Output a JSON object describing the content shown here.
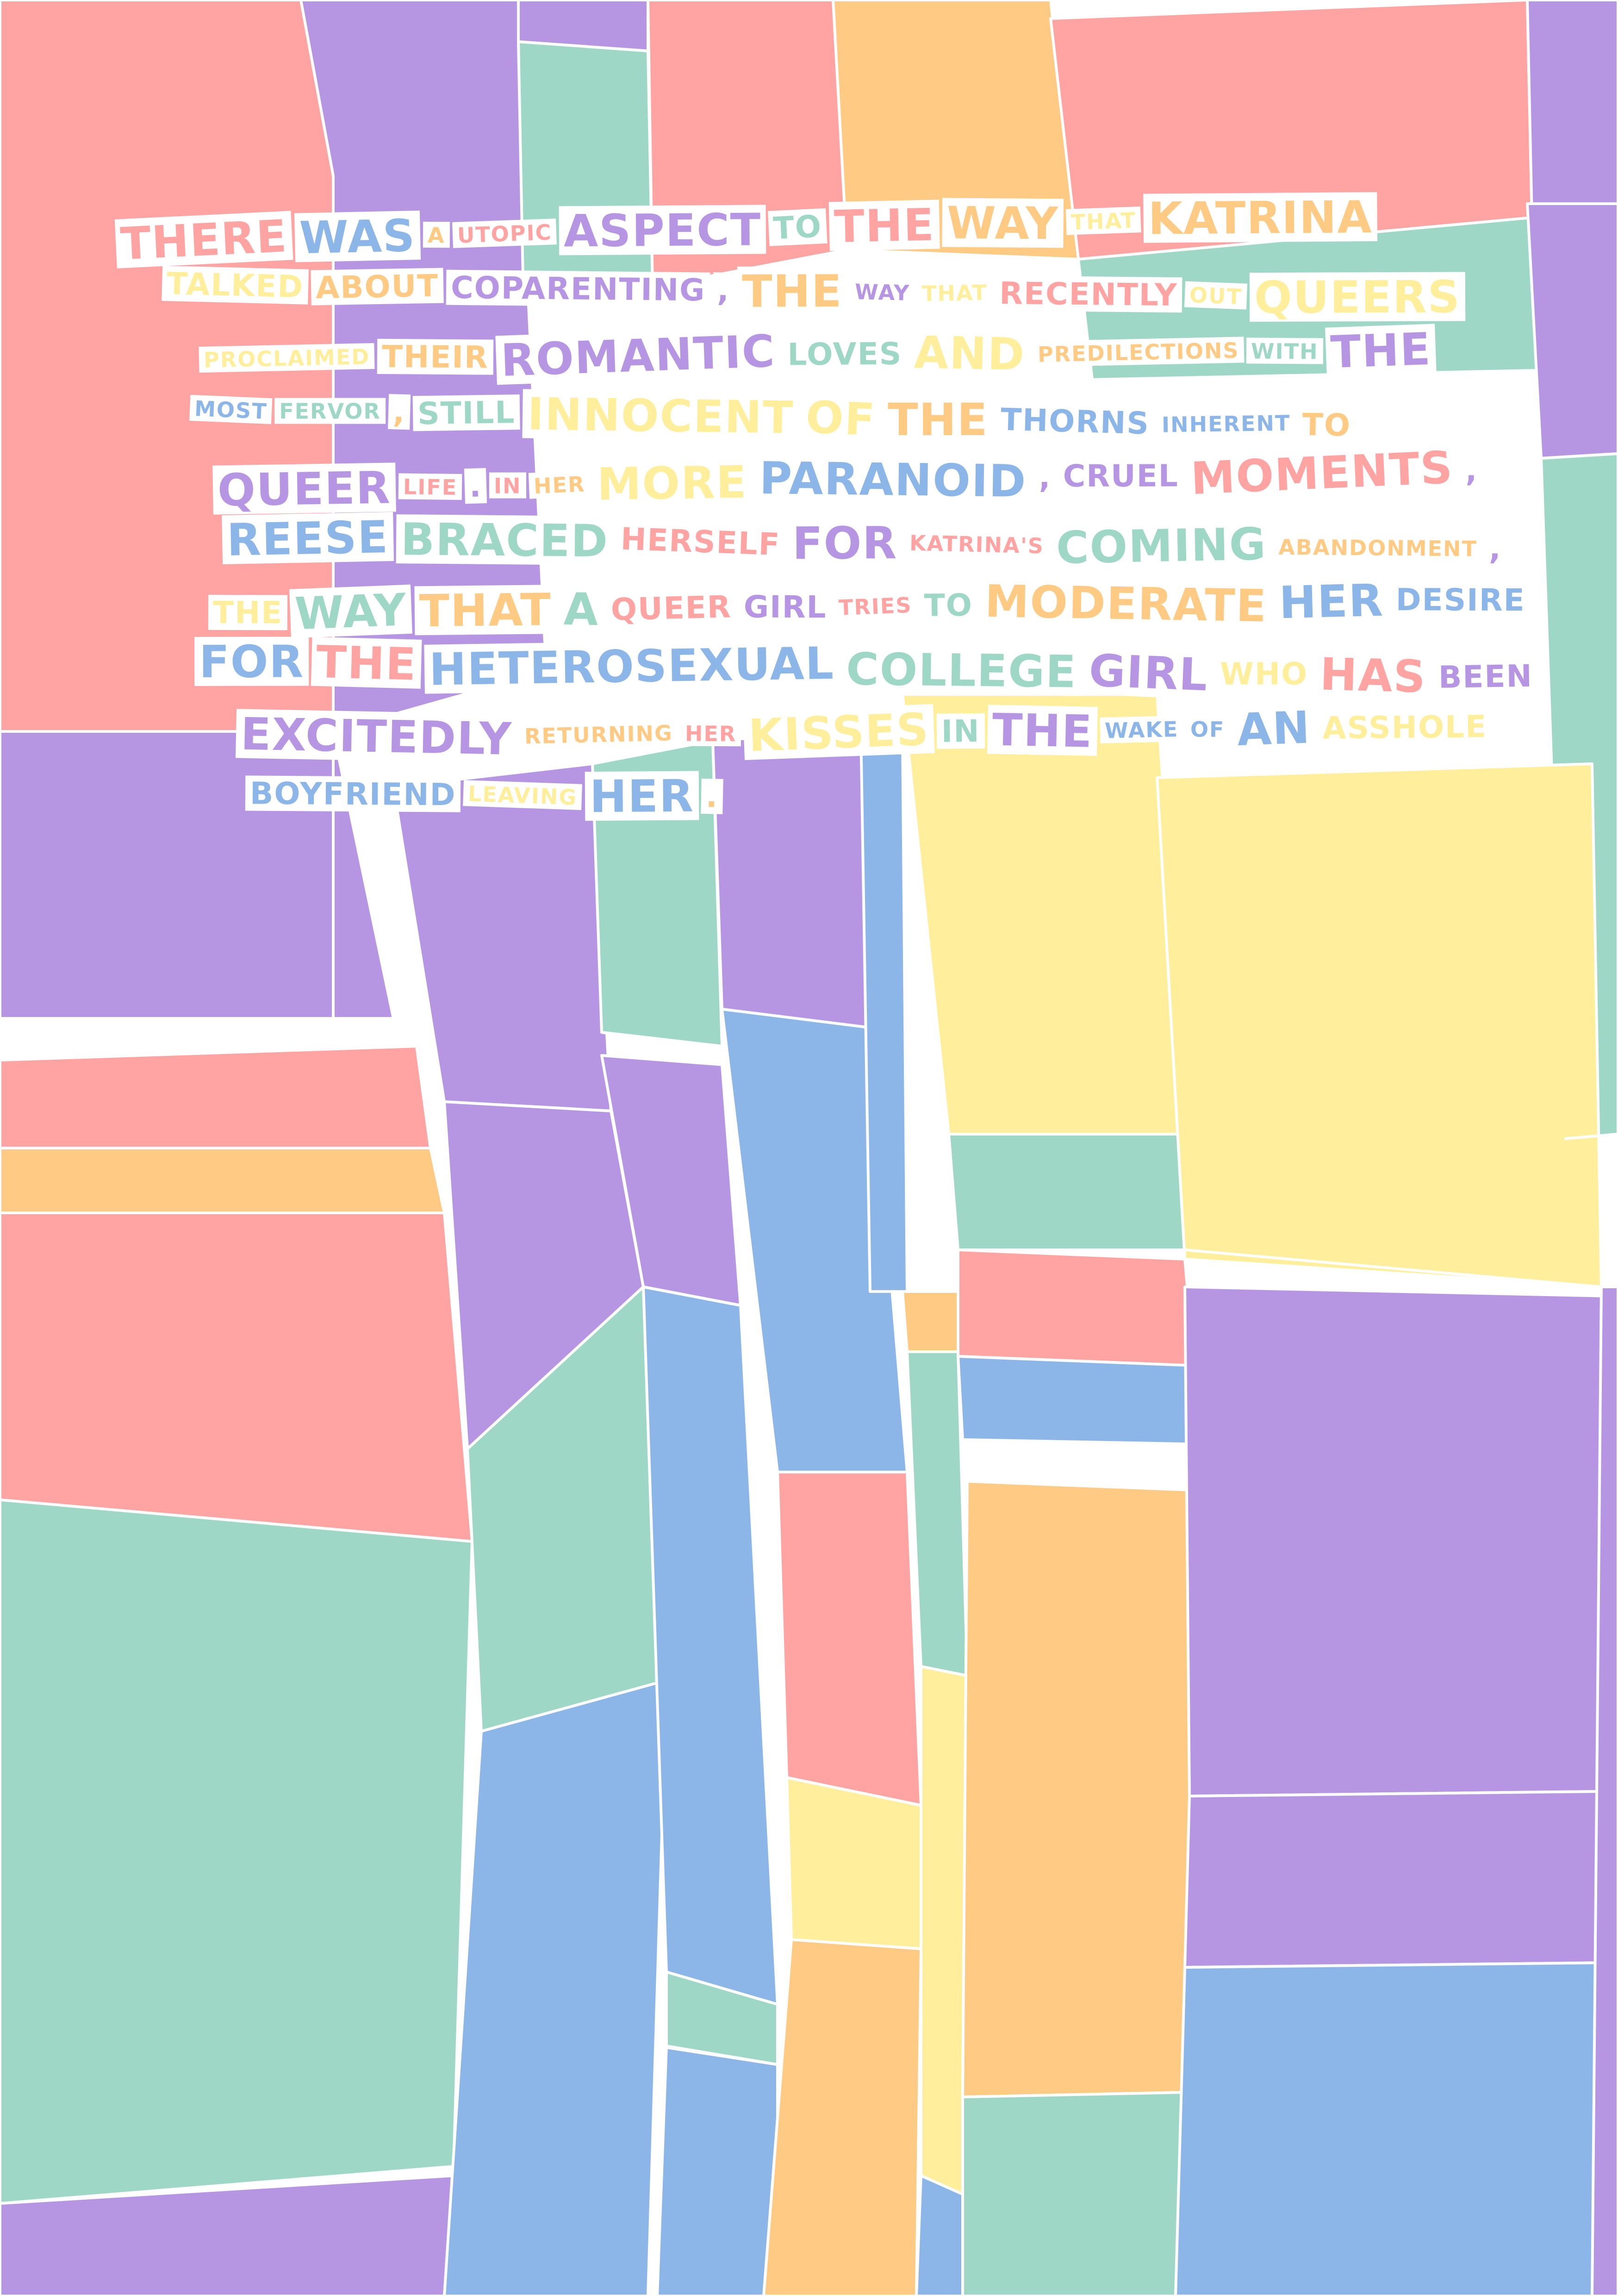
{
  "palette": {
    "pink": "#FFA3A3",
    "purple": "#B696E2",
    "mint": "#9ED7C6",
    "orange": "#FFCA84",
    "yellow": "#FFEE9B",
    "blue": "#8DB6E8",
    "white": "#FFFFFF"
  },
  "passage": {
    "lines": [
      [
        {
          "t": "There",
          "c": "pink",
          "s": "l"
        },
        {
          "t": "was",
          "c": "blue",
          "s": "l"
        },
        {
          "t": "a",
          "c": "orange",
          "s": "s"
        },
        {
          "t": "utopic",
          "c": "pink",
          "s": "s"
        },
        {
          "t": "aspect",
          "c": "purple",
          "s": "l"
        },
        {
          "t": "to",
          "c": "mint",
          "s": "m"
        },
        {
          "t": "the",
          "c": "pink",
          "s": "l"
        },
        {
          "t": "way",
          "c": "orange",
          "s": "l"
        },
        {
          "t": "that",
          "c": "yellow",
          "s": "s"
        },
        {
          "t": "Katrina",
          "c": "orange",
          "s": "l"
        }
      ],
      [
        {
          "t": "talked",
          "c": "yellow",
          "s": "m"
        },
        {
          "t": "about",
          "c": "orange",
          "s": "m"
        },
        {
          "t": "coparenting",
          "c": "purple",
          "s": "m"
        },
        {
          "t": ",",
          "c": "purple",
          "s": "m"
        },
        {
          "t": "the",
          "c": "orange",
          "s": "l"
        },
        {
          "t": "way",
          "c": "purple",
          "s": "s"
        },
        {
          "t": "that",
          "c": "yellow",
          "s": "s"
        },
        {
          "t": "recently",
          "c": "pink",
          "s": "m"
        },
        {
          "t": "out",
          "c": "yellow",
          "s": "s"
        },
        {
          "t": "queers",
          "c": "yellow",
          "s": "l"
        }
      ],
      [
        {
          "t": "proclaimed",
          "c": "yellow",
          "s": "s"
        },
        {
          "t": "their",
          "c": "orange",
          "s": "m"
        },
        {
          "t": "romantic",
          "c": "purple",
          "s": "l"
        },
        {
          "t": "loves",
          "c": "mint",
          "s": "m"
        },
        {
          "t": "and",
          "c": "yellow",
          "s": "l"
        },
        {
          "t": "predilections",
          "c": "orange",
          "s": "s"
        },
        {
          "t": "with",
          "c": "mint",
          "s": "s"
        },
        {
          "t": "the",
          "c": "purple",
          "s": "l"
        }
      ],
      [
        {
          "t": "most",
          "c": "blue",
          "s": "s"
        },
        {
          "t": "fervor",
          "c": "mint",
          "s": "s"
        },
        {
          "t": ",",
          "c": "orange",
          "s": "m"
        },
        {
          "t": "still",
          "c": "mint",
          "s": "m"
        },
        {
          "t": "innocent",
          "c": "yellow",
          "s": "l"
        },
        {
          "t": "of",
          "c": "yellow",
          "s": "l"
        },
        {
          "t": "the",
          "c": "orange",
          "s": "l"
        },
        {
          "t": "thorns",
          "c": "blue",
          "s": "m"
        },
        {
          "t": "inherent",
          "c": "blue",
          "s": "s"
        },
        {
          "t": "to",
          "c": "orange",
          "s": "m"
        }
      ],
      [
        {
          "t": "queer",
          "c": "purple",
          "s": "l"
        },
        {
          "t": "life",
          "c": "pink",
          "s": "s"
        },
        {
          "t": ".",
          "c": "purple",
          "s": "m"
        },
        {
          "t": "in",
          "c": "pink",
          "s": "s"
        },
        {
          "t": "her",
          "c": "orange",
          "s": "s"
        },
        {
          "t": "more",
          "c": "yellow",
          "s": "l"
        },
        {
          "t": "paranoid",
          "c": "blue",
          "s": "l"
        },
        {
          "t": ",",
          "c": "purple",
          "s": "m"
        },
        {
          "t": "cruel",
          "c": "purple",
          "s": "m"
        },
        {
          "t": "moments",
          "c": "pink",
          "s": "l"
        },
        {
          "t": ",",
          "c": "purple",
          "s": "m"
        }
      ],
      [
        {
          "t": "Reese",
          "c": "blue",
          "s": "l"
        },
        {
          "t": "braced",
          "c": "mint",
          "s": "l"
        },
        {
          "t": "herself",
          "c": "pink",
          "s": "m"
        },
        {
          "t": "for",
          "c": "purple",
          "s": "l"
        },
        {
          "t": "Katrina's",
          "c": "pink",
          "s": "s"
        },
        {
          "t": "coming",
          "c": "mint",
          "s": "l"
        },
        {
          "t": "abandonment",
          "c": "orange",
          "s": "s"
        },
        {
          "t": ",",
          "c": "purple",
          "s": "m"
        }
      ],
      [
        {
          "t": "the",
          "c": "yellow",
          "s": "m"
        },
        {
          "t": "way",
          "c": "mint",
          "s": "l"
        },
        {
          "t": "that",
          "c": "orange",
          "s": "l"
        },
        {
          "t": "a",
          "c": "mint",
          "s": "l"
        },
        {
          "t": "queer",
          "c": "pink",
          "s": "m"
        },
        {
          "t": "girl",
          "c": "purple",
          "s": "m"
        },
        {
          "t": "tries",
          "c": "pink",
          "s": "s"
        },
        {
          "t": "to",
          "c": "mint",
          "s": "m"
        },
        {
          "t": "moderate",
          "c": "orange",
          "s": "l"
        },
        {
          "t": "her",
          "c": "blue",
          "s": "l"
        },
        {
          "t": "desire",
          "c": "blue",
          "s": "m"
        }
      ],
      [
        {
          "t": "for",
          "c": "blue",
          "s": "l"
        },
        {
          "t": "the",
          "c": "pink",
          "s": "l"
        },
        {
          "t": "heterosexual",
          "c": "blue",
          "s": "l"
        },
        {
          "t": "college",
          "c": "mint",
          "s": "l"
        },
        {
          "t": "girl",
          "c": "purple",
          "s": "l"
        },
        {
          "t": "who",
          "c": "yellow",
          "s": "m"
        },
        {
          "t": "has",
          "c": "pink",
          "s": "l"
        },
        {
          "t": "been",
          "c": "purple",
          "s": "m"
        }
      ],
      [
        {
          "t": "excitedly",
          "c": "purple",
          "s": "l"
        },
        {
          "t": "returning",
          "c": "orange",
          "s": "s"
        },
        {
          "t": "her",
          "c": "pink",
          "s": "s"
        },
        {
          "t": "kisses",
          "c": "yellow",
          "s": "l"
        },
        {
          "t": "in",
          "c": "mint",
          "s": "m"
        },
        {
          "t": "the",
          "c": "purple",
          "s": "l"
        },
        {
          "t": "wake",
          "c": "blue",
          "s": "s"
        },
        {
          "t": "of",
          "c": "blue",
          "s": "s"
        },
        {
          "t": "an",
          "c": "blue",
          "s": "l"
        },
        {
          "t": "asshole",
          "c": "yellow",
          "s": "m"
        }
      ],
      [
        {
          "t": "boyfriend",
          "c": "blue",
          "s": "m"
        },
        {
          "t": "leaving",
          "c": "yellow",
          "s": "s"
        },
        {
          "t": "her",
          "c": "blue",
          "s": "l"
        },
        {
          "t": ".",
          "c": "orange",
          "s": "m"
        }
      ]
    ]
  }
}
